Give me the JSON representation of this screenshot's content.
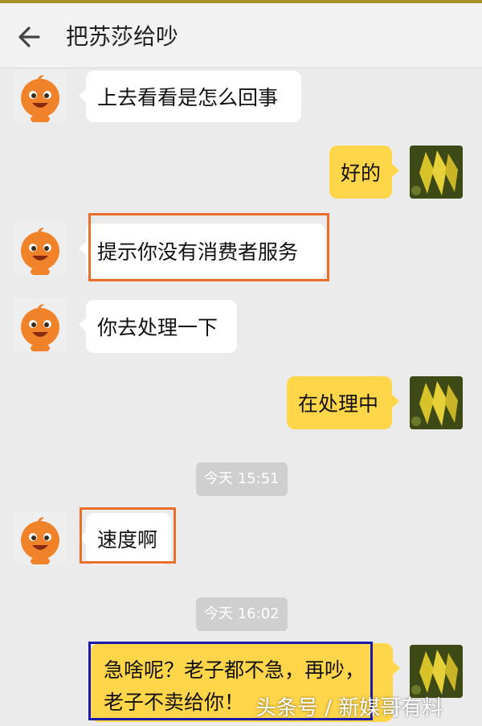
{
  "header": {
    "title": "把苏莎给吵",
    "back_icon": "arrow-left-icon"
  },
  "messages": [
    {
      "side": "left",
      "text": "上去看看是怎么回事"
    },
    {
      "side": "right",
      "text": "好的"
    },
    {
      "side": "left",
      "text": "提示你没有消费者服务"
    },
    {
      "side": "left",
      "text": "你去处理一下"
    },
    {
      "side": "right",
      "text": "在处理中"
    },
    {
      "side": "left",
      "text": "速度啊"
    },
    {
      "side": "right",
      "text": "急啥呢？老子都不急，再吵，老子不卖给你！"
    }
  ],
  "timestamps": [
    "今天 15:51",
    "今天 16:02"
  ],
  "watermark": "头条号 / 新媒哥有料",
  "colors": {
    "right_bubble": "#ffd54a",
    "left_bubble": "#ffffff",
    "background": "#ebebeb",
    "highlight_orange": "#e8702a",
    "highlight_blue": "#1a1aa8"
  }
}
